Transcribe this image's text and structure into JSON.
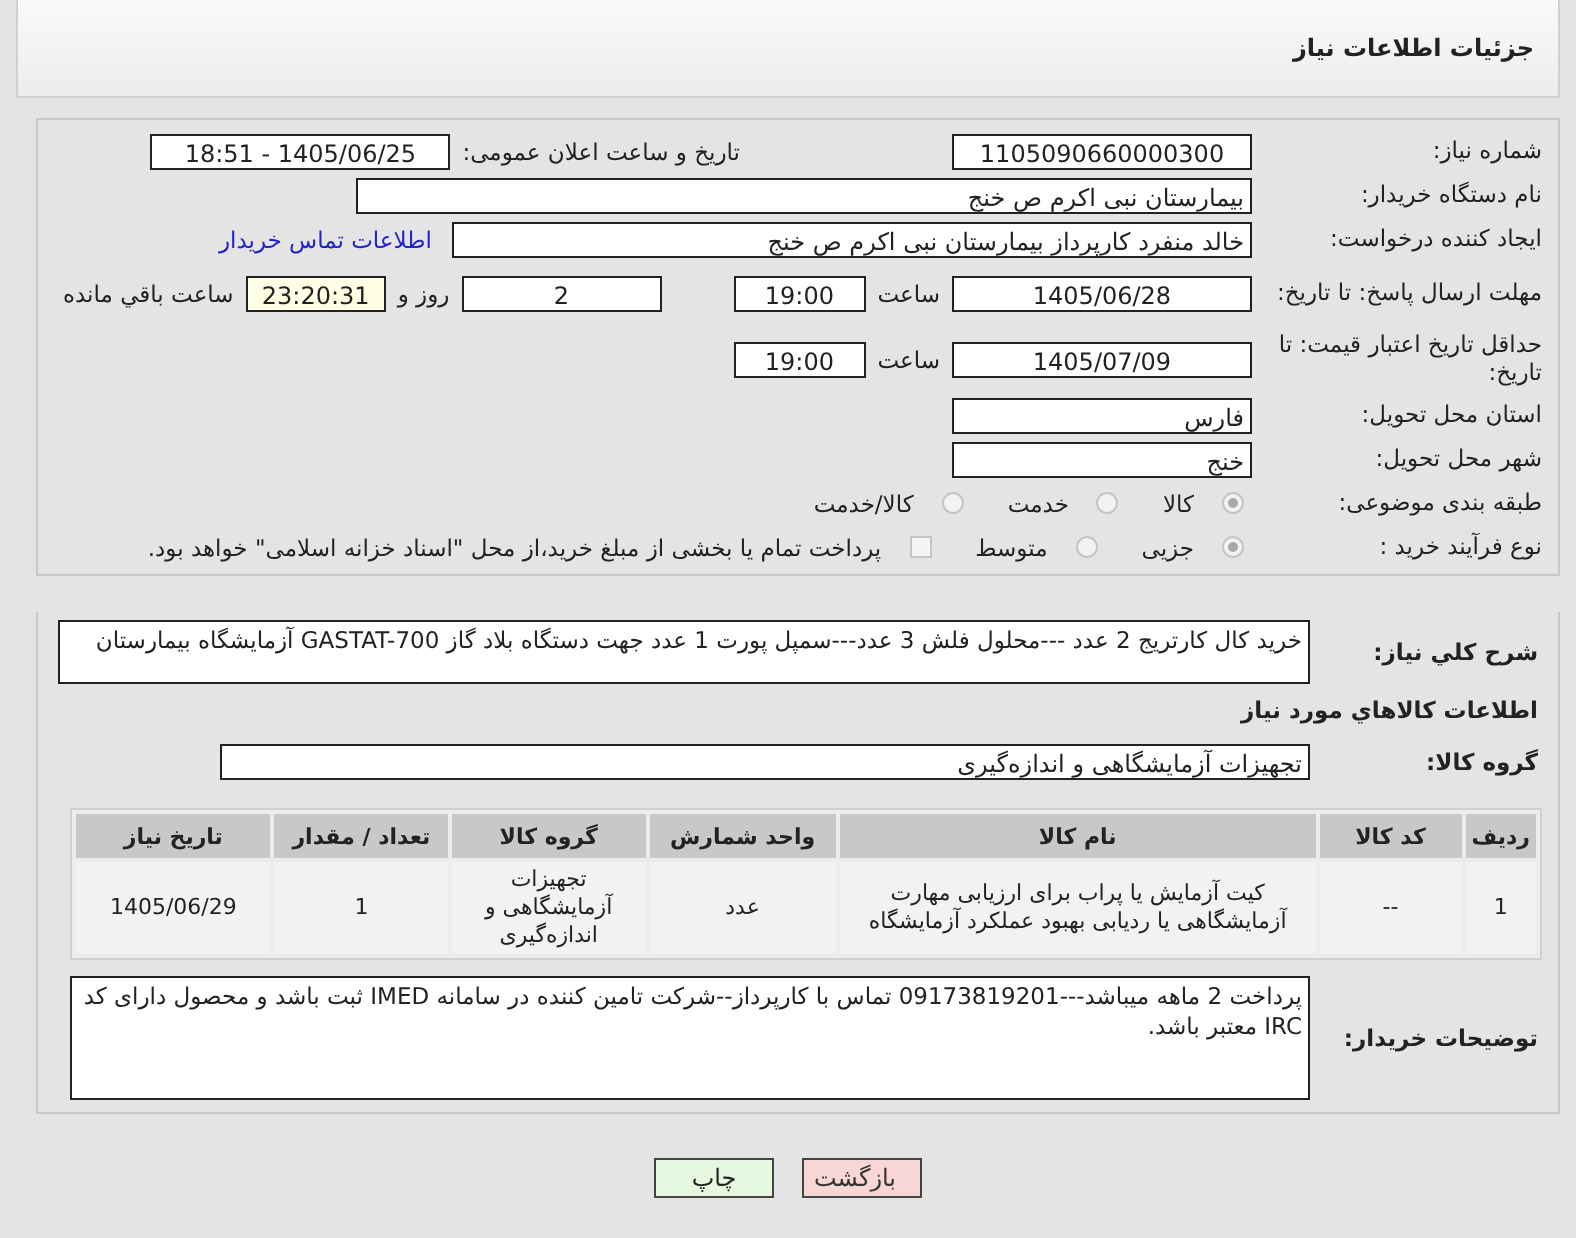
{
  "header": {
    "title": "جزئیات اطلاعات نیاز"
  },
  "need_number": {
    "label": "شماره نیاز:",
    "value": "1105090660000300"
  },
  "announce": {
    "label": "تاریخ و ساعت اعلان عمومی:",
    "value": "1405/06/25 - 18:51"
  },
  "buyer": {
    "label": "نام دستگاه خریدار:",
    "value": "بیمارستان نبی اکرم  ص  خنج"
  },
  "creator": {
    "label": "ایجاد کننده درخواست:",
    "value": "خالد منفرد کارپرداز بیمارستان نبی اکرم  ص  خنج",
    "link": "اطلاعات تماس خریدار"
  },
  "deadline": {
    "label": "مهلت ارسال پاسخ: تا تاریخ:",
    "date": "1405/06/28",
    "time_label": "ساعت",
    "time": "19:00",
    "days": "2",
    "days_label": "روز و",
    "remaining": "23:20:31",
    "remaining_label": "ساعت باقي مانده"
  },
  "validity": {
    "label": "حداقل تاریخ اعتبار قیمت: تا تاریخ:",
    "date": "1405/07/09",
    "time_label": "ساعت",
    "time": "19:00"
  },
  "province": {
    "label": "استان محل تحویل:",
    "value": "فارس"
  },
  "city": {
    "label": "شهر محل تحویل:",
    "value": "خنج"
  },
  "category": {
    "label": "طبقه بندی موضوعی:",
    "options": [
      {
        "label": "کالا",
        "selected": true
      },
      {
        "label": "خدمت",
        "selected": false
      },
      {
        "label": "کالا/خدمت",
        "selected": false
      }
    ]
  },
  "process": {
    "label": "نوع فرآیند خرید :",
    "options": [
      {
        "label": "جزیی",
        "selected": true
      },
      {
        "label": "متوسط",
        "selected": false
      }
    ],
    "payment": {
      "label": "پرداخت تمام یا بخشی از مبلغ خرید،از محل \"اسناد خزانه اسلامی\" خواهد بود.",
      "checked": false
    }
  },
  "description": {
    "label": "شرح کلي نياز:",
    "value": "خرید  کال کارتریج 2 عدد ---محلول فلش 3 عدد---سمپل پورت 1 عدد جهت دستگاه بلاد گاز GASTAT-700 آزمایشگاه بیمارستان"
  },
  "goods_heading": "اطلاعات کالاهاي مورد نياز",
  "goods_group": {
    "label": "گروه کالا:",
    "value": "تجهیزات آزمایشگاهی و اندازه‌گیری"
  },
  "table": {
    "columns": [
      "ردیف",
      "کد کالا",
      "نام کالا",
      "واحد شمارش",
      "گروه کالا",
      "تعداد / مقدار",
      "تاریخ نیاز"
    ],
    "rows": [
      [
        "1",
        "--",
        "کیت آزمایش یا پراب برای ارزیابی مهارت آزمایشگاهی یا ردیابی بهبود عملکرد آزمایشگاه",
        "عدد",
        "تجهیزات آزمایشگاهی و اندازه‌گیری",
        "1",
        "1405/06/29"
      ]
    ]
  },
  "notes": {
    "label": "توضیحات خریدار:",
    "value": "پرداخت 2 ماهه میباشد---09173819201 تماس با کارپرداز--شرکت تامین کننده در سامانه IMED  ثبت باشد و محصول دارای کد IRC  معتبر باشد."
  },
  "buttons": [
    {
      "label": "بازگشت",
      "kind": "back"
    },
    {
      "label": "چاپ",
      "kind": "print"
    }
  ]
}
